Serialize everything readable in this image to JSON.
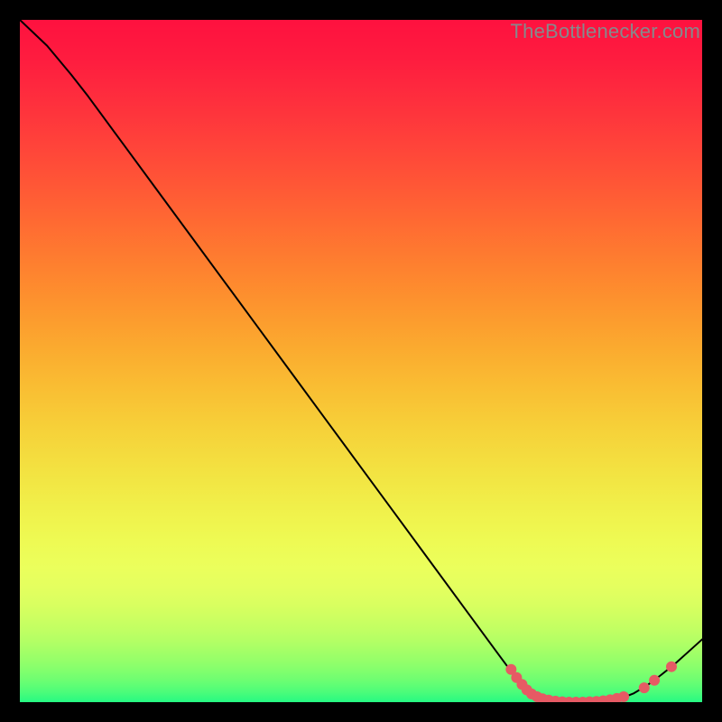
{
  "watermark": "TheBottlenecker.com",
  "chart_data": {
    "type": "line",
    "title": "",
    "xlabel": "",
    "ylabel": "",
    "xlim": [
      0,
      100
    ],
    "ylim": [
      0,
      100
    ],
    "curve": [
      {
        "x": 0,
        "y": 100.0
      },
      {
        "x": 4,
        "y": 96.2
      },
      {
        "x": 7.5,
        "y": 92.0
      },
      {
        "x": 10,
        "y": 88.8
      },
      {
        "x": 15,
        "y": 82.0
      },
      {
        "x": 20,
        "y": 75.2
      },
      {
        "x": 25,
        "y": 68.4
      },
      {
        "x": 30,
        "y": 61.6
      },
      {
        "x": 35,
        "y": 54.8
      },
      {
        "x": 40,
        "y": 48.0
      },
      {
        "x": 45,
        "y": 41.2
      },
      {
        "x": 50,
        "y": 34.4
      },
      {
        "x": 55,
        "y": 27.6
      },
      {
        "x": 60,
        "y": 20.8
      },
      {
        "x": 65,
        "y": 14.0
      },
      {
        "x": 70,
        "y": 7.2
      },
      {
        "x": 74,
        "y": 1.8
      },
      {
        "x": 76,
        "y": 0.6
      },
      {
        "x": 80,
        "y": 0.0
      },
      {
        "x": 84,
        "y": 0.0
      },
      {
        "x": 88,
        "y": 0.5
      },
      {
        "x": 90,
        "y": 1.3
      },
      {
        "x": 92,
        "y": 2.5
      },
      {
        "x": 94,
        "y": 4.0
      },
      {
        "x": 96,
        "y": 5.6
      },
      {
        "x": 98,
        "y": 7.4
      },
      {
        "x": 100,
        "y": 9.2
      }
    ],
    "markers": [
      {
        "x": 72.0,
        "y": 4.8
      },
      {
        "x": 72.8,
        "y": 3.6
      },
      {
        "x": 73.6,
        "y": 2.6
      },
      {
        "x": 74.3,
        "y": 1.8
      },
      {
        "x": 75.0,
        "y": 1.2
      },
      {
        "x": 75.8,
        "y": 0.8
      },
      {
        "x": 76.6,
        "y": 0.5
      },
      {
        "x": 77.5,
        "y": 0.3
      },
      {
        "x": 78.5,
        "y": 0.15
      },
      {
        "x": 79.5,
        "y": 0.05
      },
      {
        "x": 80.5,
        "y": 0.0
      },
      {
        "x": 81.5,
        "y": 0.0
      },
      {
        "x": 82.5,
        "y": 0.0
      },
      {
        "x": 83.5,
        "y": 0.05
      },
      {
        "x": 84.5,
        "y": 0.1
      },
      {
        "x": 85.5,
        "y": 0.2
      },
      {
        "x": 86.5,
        "y": 0.35
      },
      {
        "x": 87.5,
        "y": 0.55
      },
      {
        "x": 88.5,
        "y": 0.8
      },
      {
        "x": 91.5,
        "y": 2.1
      },
      {
        "x": 93.0,
        "y": 3.2
      },
      {
        "x": 95.5,
        "y": 5.2
      }
    ],
    "marker_color": "#e65a64",
    "marker_radius": 6,
    "line_color": "#000000",
    "line_width": 2,
    "gradient_stops": [
      {
        "offset": 0.0,
        "color": "#fe113f"
      },
      {
        "offset": 0.06,
        "color": "#fe1d3f"
      },
      {
        "offset": 0.12,
        "color": "#fe2f3d"
      },
      {
        "offset": 0.18,
        "color": "#ff423a"
      },
      {
        "offset": 0.24,
        "color": "#ff5636"
      },
      {
        "offset": 0.3,
        "color": "#ff6b32"
      },
      {
        "offset": 0.36,
        "color": "#fe802f"
      },
      {
        "offset": 0.42,
        "color": "#fd952e"
      },
      {
        "offset": 0.48,
        "color": "#fbaa2f"
      },
      {
        "offset": 0.54,
        "color": "#f9be33"
      },
      {
        "offset": 0.6,
        "color": "#f6d139"
      },
      {
        "offset": 0.66,
        "color": "#f3e241"
      },
      {
        "offset": 0.72,
        "color": "#f0f14b"
      },
      {
        "offset": 0.763,
        "color": "#eefa53"
      },
      {
        "offset": 0.803,
        "color": "#ebff5c"
      },
      {
        "offset": 0.832,
        "color": "#e4ff5f"
      },
      {
        "offset": 0.857,
        "color": "#d9ff60"
      },
      {
        "offset": 0.878,
        "color": "#ccff61"
      },
      {
        "offset": 0.896,
        "color": "#bfff63"
      },
      {
        "offset": 0.912,
        "color": "#b2ff65"
      },
      {
        "offset": 0.925,
        "color": "#a4ff67"
      },
      {
        "offset": 0.937,
        "color": "#97ff69"
      },
      {
        "offset": 0.948,
        "color": "#8aff6c"
      },
      {
        "offset": 0.957,
        "color": "#7dff6e"
      },
      {
        "offset": 0.966,
        "color": "#70fe71"
      },
      {
        "offset": 0.973,
        "color": "#63fe74"
      },
      {
        "offset": 0.98,
        "color": "#56fd77"
      },
      {
        "offset": 0.986,
        "color": "#4afc7a"
      },
      {
        "offset": 0.991,
        "color": "#3dfb7d"
      },
      {
        "offset": 0.996,
        "color": "#31fa80"
      },
      {
        "offset": 1.0,
        "color": "#25f983"
      }
    ]
  }
}
